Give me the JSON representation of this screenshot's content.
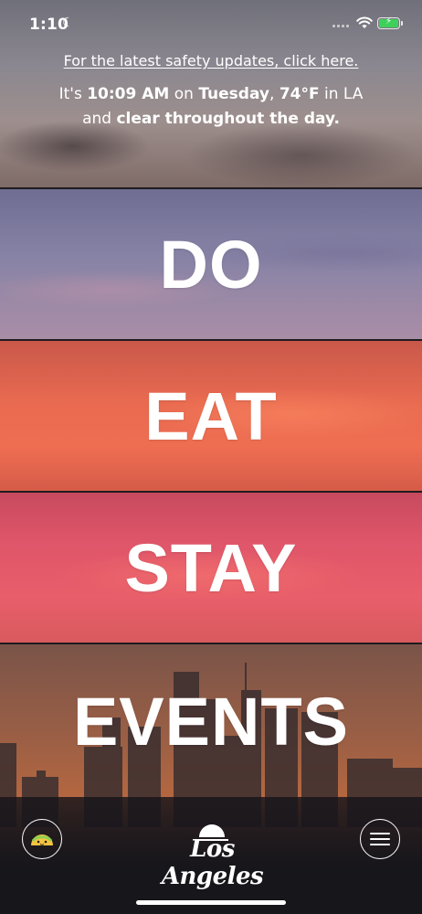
{
  "status_bar": {
    "time": "1:10",
    "moon_icon": "moon-icon",
    "wifi_icon": "wifi-icon",
    "battery_icon": "battery-charging-icon",
    "battery_color": "#3ed05a"
  },
  "header": {
    "safety_link": "For the latest safety updates, click here.",
    "weather": {
      "prefix": "It's ",
      "time": "10:09 AM",
      "on": " on ",
      "day": "Tuesday",
      "comma": ", ",
      "temp": "74°F",
      "in": " in LA",
      "and": "and ",
      "condition": "clear throughout the day."
    }
  },
  "categories": [
    {
      "label": "DO",
      "color": "#8683a6"
    },
    {
      "label": "EAT",
      "color": "#e86a50"
    },
    {
      "label": "STAY",
      "color": "#e0566a"
    },
    {
      "label": "EVENTS",
      "color": "#b8683f"
    }
  ],
  "bottom_bar": {
    "taco_icon": "taco-icon",
    "logo_text": "Los Angeles",
    "menu_icon": "hamburger-menu-icon"
  }
}
